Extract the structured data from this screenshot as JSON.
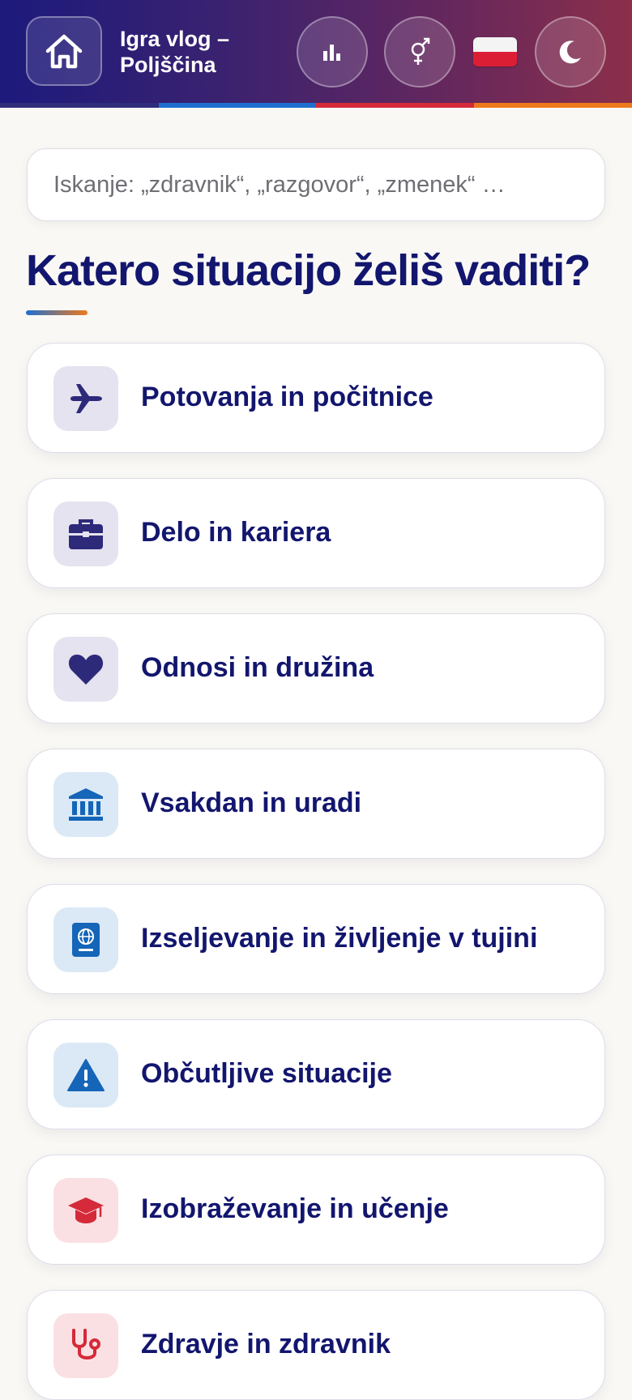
{
  "header": {
    "title": "Igra vlog – Poljščina",
    "home_icon": "home-icon",
    "stats_icon": "bar-chart-icon",
    "gender_icon": "gender-icon",
    "flag": "poland-flag",
    "theme_icon": "moon-icon",
    "colors": {
      "gradient_start": "#1c1a7c",
      "gradient_end": "#8b2f4a"
    }
  },
  "search": {
    "placeholder": "Iskanje: „zdravnik“, „razgovor“, „zmenek“ …",
    "value": ""
  },
  "main": {
    "heading": "Katero situacijo želiš vaditi?",
    "categories": [
      {
        "label": "Potovanja in počitnice",
        "icon": "airplane-icon",
        "color": "#2e2a7a"
      },
      {
        "label": "Delo in kariera",
        "icon": "briefcase-icon",
        "color": "#2e2a7a"
      },
      {
        "label": "Odnosi in družina",
        "icon": "heart-icon",
        "color": "#2e2a7a"
      },
      {
        "label": "Vsakdan in uradi",
        "icon": "bank-icon",
        "color": "#1565b8"
      },
      {
        "label": "Izseljevanje in življenje v tujini",
        "icon": "passport-icon",
        "color": "#1565b8"
      },
      {
        "label": "Občutljive situacije",
        "icon": "warning-icon",
        "color": "#1565b8"
      },
      {
        "label": "Izobraževanje in učenje",
        "icon": "graduation-cap-icon",
        "color": "#d42a3a"
      },
      {
        "label": "Zdravje in zdravnik",
        "icon": "stethoscope-icon",
        "color": "#d42a3a"
      }
    ]
  }
}
